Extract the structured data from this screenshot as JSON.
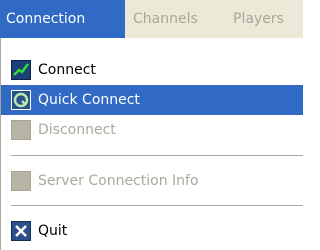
{
  "menubar": {
    "tabs": [
      {
        "label": "Connection"
      },
      {
        "label": "Channels"
      },
      {
        "label": "Players"
      }
    ]
  },
  "menu": {
    "items": [
      {
        "label": "Connect",
        "icon": "connect-icon"
      },
      {
        "label": "Quick Connect",
        "icon": "quick-connect-icon"
      },
      {
        "label": "Disconnect",
        "icon": "disconnect-icon"
      },
      {
        "label": "Server Connection Info",
        "icon": "server-info-icon"
      },
      {
        "label": "Quit",
        "icon": "quit-icon"
      }
    ]
  },
  "colors": {
    "highlight": "#316ac5",
    "disabled_text": "#aca899",
    "menubar_bg": "#ece9d8"
  }
}
